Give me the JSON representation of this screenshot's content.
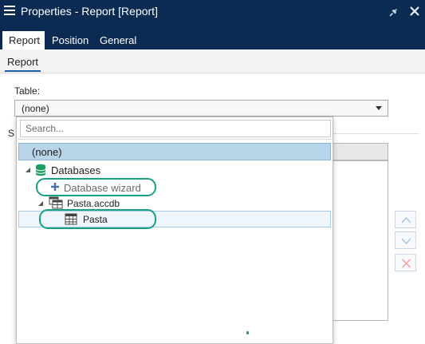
{
  "window": {
    "title": "Properties - Report [Report]",
    "menu_icon": "hamburger-icon",
    "pin_icon": "pin-icon",
    "close_icon": "close-icon",
    "bar_color": "#0b2b52"
  },
  "tabs": [
    {
      "label": "Report",
      "active": true
    },
    {
      "label": "Position",
      "active": false
    },
    {
      "label": "General",
      "active": false
    }
  ],
  "subtabs": [
    {
      "label": "Report",
      "active": true
    }
  ],
  "table_field": {
    "label": "Table:",
    "value": "(none)"
  },
  "background": {
    "section_label_visible": "S"
  },
  "dropdown": {
    "search_placeholder": "Search...",
    "items": {
      "none": "(none)",
      "databases": "Databases",
      "wizard": "Database wizard",
      "file": "Pasta.accdb",
      "table": "Pasta"
    },
    "selected_color": "#b8d4e8",
    "highlight_color": "#18a085"
  },
  "side_buttons": [
    {
      "icon": "move-up-icon"
    },
    {
      "icon": "move-down-icon"
    },
    {
      "icon": "delete-icon"
    }
  ]
}
